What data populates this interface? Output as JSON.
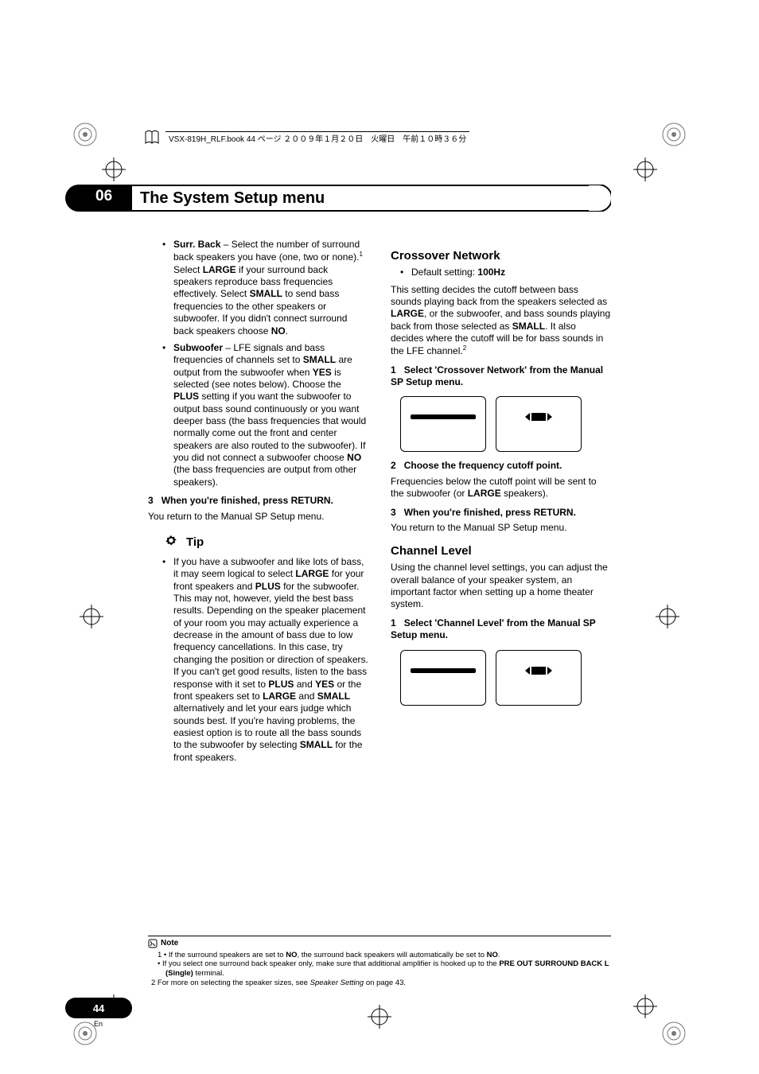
{
  "bookbar": "VSX-819H_RLF.book  44 ページ  ２００９年１月２０日　火曜日　午前１０時３６分",
  "chapter": {
    "num": "06",
    "title": "The System Setup menu"
  },
  "left": {
    "surr_back_label": "Surr. Back",
    "surr_back_text1": " – Select the number of surround back speakers you have (one, two or none).",
    "sup1": "1",
    "surr_back_text2a": " Select ",
    "large": "LARGE",
    "surr_back_text2b": " if your surround back speakers reproduce bass frequencies effectively. Select ",
    "small": "SMALL",
    "surr_back_text2c": " to send bass frequencies to the other speakers or subwoofer. If you didn't connect surround back speakers choose ",
    "no": "NO",
    "period": ".",
    "sub_label": "Subwoofer",
    "sub_text1": " – LFE signals and bass frequencies of channels set to ",
    "sub_text2": " are output from the subwoofer when ",
    "yes": "YES",
    "sub_text3": " is selected (see notes below). Choose the ",
    "plus": "PLUS",
    "sub_text4": " setting if you want the subwoofer to output bass sound continuously or you want deeper bass (the bass frequencies that would normally come out the front and center speakers are also routed to the subwoofer). If you did not connect a subwoofer choose ",
    "sub_text5": " (the bass frequencies are output from other speakers).",
    "step3_num": "3",
    "step3_label": "When you're finished, press RETURN.",
    "step3_after": "You return to the Manual SP Setup menu.",
    "tip_label": "Tip",
    "tip_text1": "If you have a subwoofer and like lots of bass, it may seem logical to select ",
    "tip_text2": " for your front speakers and ",
    "tip_text3": " for the subwoofer. This may not, however, yield the best bass results. Depending on the speaker placement of your room you may actually experience a decrease in the amount of bass due to low frequency cancellations. In this case, try changing the position or direction of speakers. If you can't get good results, listen to the bass response with it set to ",
    "tip_text4": " and ",
    "tip_text5": " or the front speakers set to ",
    "tip_text6": " alternatively and let your ears judge which sounds best. If you're having problems, the easiest option is to route all the bass sounds to the subwoofer by selecting ",
    "tip_text7": " for the front speakers."
  },
  "right": {
    "h_crossover": "Crossover Network",
    "default_label": "Default setting: ",
    "default_val": "100Hz",
    "cross_p1a": "This setting decides the cutoff between bass sounds playing back from the speakers selected as ",
    "cross_p1b": ", or the subwoofer, and bass sounds playing back from those selected as ",
    "cross_p1c": ". It also decides where the cutoff will be for bass sounds in the LFE channel.",
    "sup2": "2",
    "cross_step1_num": "1",
    "cross_step1": "Select 'Crossover Network' from the Manual SP Setup menu.",
    "cross_step2_num": "2",
    "cross_step2": "Choose the frequency cutoff point.",
    "cross_step2_after1": "Frequencies below the cutoff point will be sent to the subwoofer (or ",
    "cross_step2_after2": " speakers).",
    "cross_step3_num": "3",
    "cross_step3": "When you're finished, press RETURN.",
    "cross_step3_after": "You return to the Manual SP Setup menu.",
    "h_channel": "Channel Level",
    "channel_p": "Using the channel level settings, you can adjust the overall balance of your speaker system, an important factor when setting up a home theater system.",
    "channel_step1_num": "1",
    "channel_step1": "Select 'Channel Level' from the Manual SP Setup menu."
  },
  "notes": {
    "label": "Note",
    "n1a": "1 • If the surround speakers are set to ",
    "n1b": ", the surround back speakers will automatically be set to ",
    "n1c": ".",
    "n1_2a": "• If you select one surround back speaker only, make sure that additional amplifier is hooked up to the ",
    "preout": "PRE OUT SURROUND BACK L (Single)",
    "n1_2b": " terminal.",
    "n2a": "2 For more on selecting the speaker sizes, see ",
    "n2_it": "Speaker Setting",
    "n2b": " on page 43."
  },
  "page": {
    "num": "44",
    "lang": "En"
  }
}
